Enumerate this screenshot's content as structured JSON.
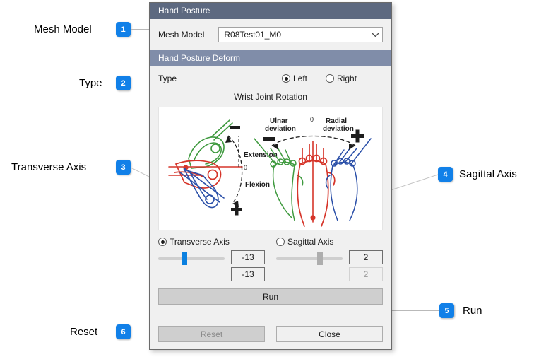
{
  "annotations": [
    {
      "number": "1",
      "label": "Mesh Model"
    },
    {
      "number": "2",
      "label": "Type"
    },
    {
      "number": "3",
      "label": "Transverse Axis"
    },
    {
      "number": "4",
      "label": "Sagittal Axis"
    },
    {
      "number": "5",
      "label": "Run"
    },
    {
      "number": "6",
      "label": "Reset"
    }
  ],
  "dialog": {
    "group1_title": "Hand Posture",
    "group2_title": "Hand Posture Deform",
    "mesh_model": {
      "label": "Mesh Model",
      "value": "R08Test01_M0",
      "chevron": "chevron-down-icon"
    },
    "type": {
      "label": "Type",
      "options": [
        {
          "label": "Left",
          "selected": true
        },
        {
          "label": "Right",
          "selected": false
        }
      ]
    },
    "figure_caption": "Wrist Joint Rotation",
    "figure": {
      "left_panel": {
        "minus_sign": "–",
        "plus_sign": "+",
        "zero_label": "0",
        "extension_label": "Extension",
        "flexion_label": "Flexion"
      },
      "right_panel": {
        "zero_label": "0",
        "ulnar_label_line1": "Ulnar",
        "ulnar_label_line2": "deviation",
        "radial_label_line1": "Radial",
        "radial_label_line2": "deviation",
        "minus_sign": "–",
        "plus_sign": "+"
      }
    },
    "axes": [
      {
        "label": "Transverse Axis",
        "selected": true,
        "slider_percent": 35,
        "value_top": "-13",
        "value_bottom": "-13",
        "enabled": true
      },
      {
        "label": "Sagittal Axis",
        "selected": false,
        "slider_percent": 62,
        "value_top": "2",
        "value_bottom": "2",
        "enabled": false
      }
    ],
    "run_button": "Run",
    "reset_button": "Reset",
    "close_button": "Close"
  },
  "colors": {
    "header_primary": "#5d6980",
    "header_secondary": "#808da9",
    "badge": "#1180e8",
    "slider_active": "#0a80e0",
    "slider_disabled": "#aeaeae"
  }
}
